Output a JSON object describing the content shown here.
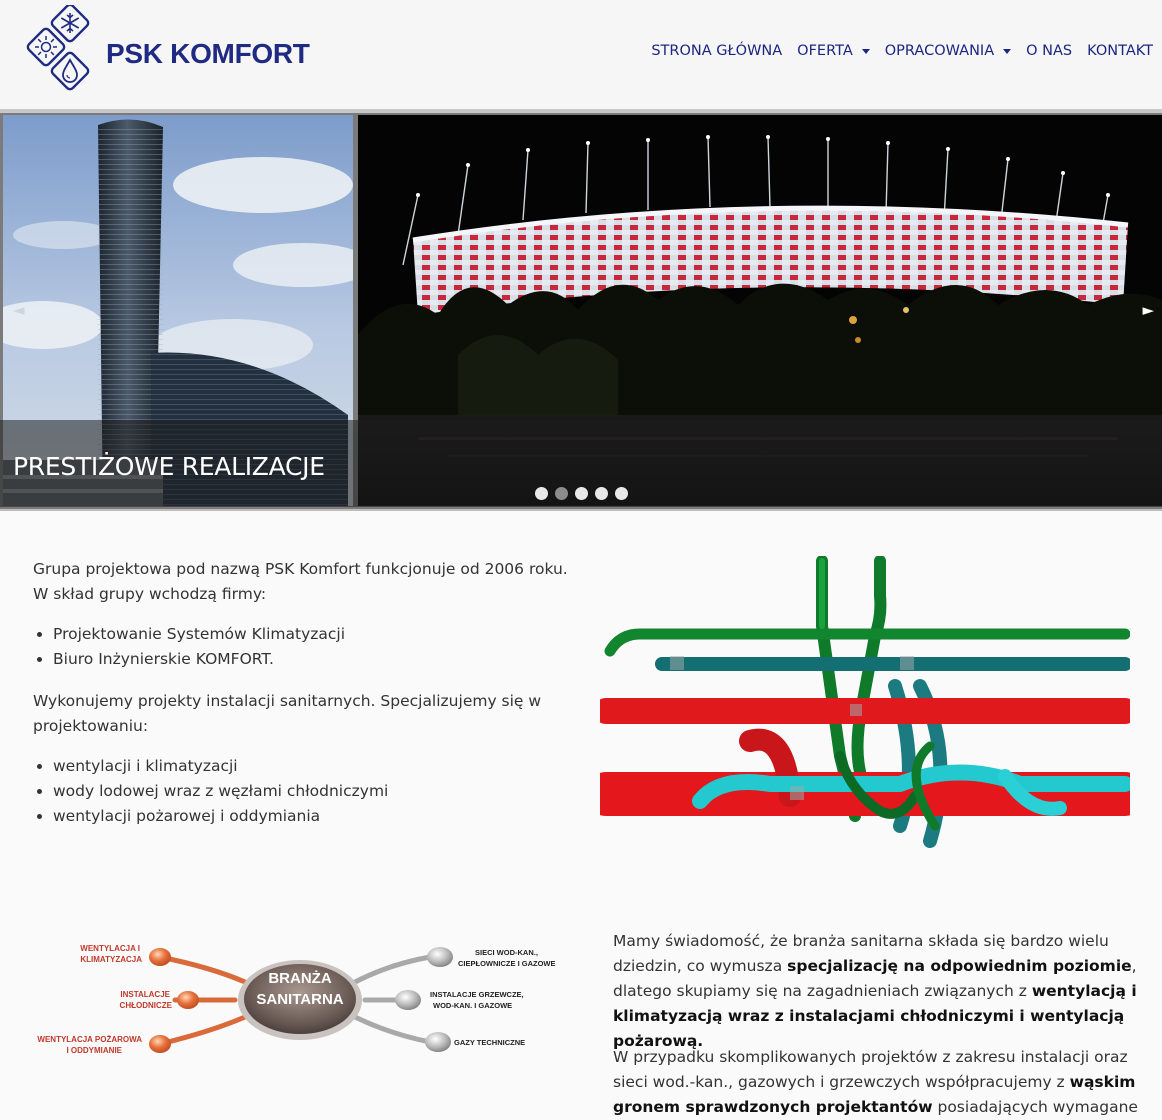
{
  "brand": {
    "name": "PSK KOMFORT",
    "accent_color": "#1f2a82",
    "logo_icons": [
      "snowflake-icon",
      "sun-icon",
      "water-drop-icon"
    ]
  },
  "nav": {
    "items": [
      {
        "label": "STRONA GŁÓWNA",
        "dropdown": false
      },
      {
        "label": "OFERTA",
        "dropdown": true
      },
      {
        "label": "OPRACOWANIA",
        "dropdown": true
      },
      {
        "label": "O NAS",
        "dropdown": false
      },
      {
        "label": "KONTAKT",
        "dropdown": false
      }
    ]
  },
  "slider": {
    "caption": "PRESTIŻOWE REALIZACJE",
    "prev_icon": "◄",
    "next_icon": "►",
    "dot_count": 5,
    "active_dot": 2
  },
  "intro": {
    "paragraph1_line1": "Grupa projektowa pod nazwą PSK Komfort funkcjonuje od 2006 roku.",
    "paragraph1_line2": "W skład grupy wchodzą firmy:",
    "companies": [
      "Projektowanie Systemów Klimatyzacji",
      "Biuro Inżynierskie KOMFORT."
    ],
    "paragraph2": "Wykonujemy projekty instalacji sanitarnych. Specjalizujemy się w projektowaniu:",
    "specializations": [
      "wentylacji i klimatyzacji",
      "wody lodowej wraz z węzłami chłodniczymi",
      "wentylacji pożarowej i oddymiania"
    ]
  },
  "diagram": {
    "center_line1": "BRANŻA",
    "center_line2": "SANITARNA",
    "left": [
      {
        "line1": "WENTYLACJA I",
        "line2": "KLIMATYZACJA"
      },
      {
        "line1": "INSTALACJE",
        "line2": "CHŁODNICZE"
      },
      {
        "line1": "WENTYLACJA POŻAROWA",
        "line2": "I ODDYMIANIE"
      }
    ],
    "right": [
      {
        "line1": "SIECI WOD-KAN.,",
        "line2": "CIEPŁOWNICZE I GAZOWE"
      },
      {
        "line1": "INSTALACJE GRZEWCZE,",
        "line2": "WOD-KAN. I GAZOWE"
      },
      {
        "line1": "GAZY TECHNICZNE",
        "line2": ""
      }
    ],
    "left_color": "#c0392b",
    "right_color": "#222222"
  },
  "body": {
    "p3_a": "Mamy świadomość, że branża sanitarna składa się bardzo wielu dziedzin, co wymusza ",
    "p3_b": "specjalizację na odpowiednim poziomie",
    "p3_c": ", dlatego skupiamy się na zagadnieniach związanych z ",
    "p3_d": "wentylacją i klimatyzacją wraz z instalacjami chłodniczymi i wentylacją pożarową.",
    "p4_a": "W przypadku skomplikowanych projektów z zakresu instalacji oraz sieci wod.-kan., gazowych i grzewczych współpracujemy z ",
    "p4_b": "wąskim gronem sprawdzonych projektantów",
    "p4_c": " posiadających wymagane"
  }
}
